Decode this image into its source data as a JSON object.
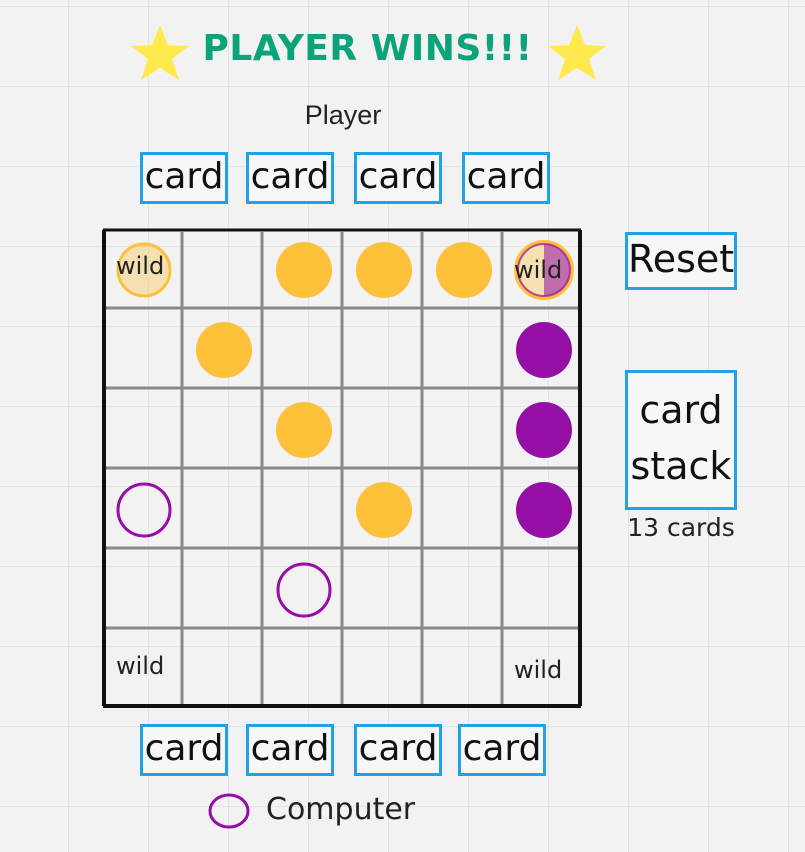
{
  "status": {
    "title": "PLAYER WINS!!!"
  },
  "player": {
    "label": "Player",
    "cards": [
      "card",
      "card",
      "card",
      "card"
    ]
  },
  "computer": {
    "label": "Computer",
    "cards": [
      "card",
      "card",
      "card",
      "card"
    ]
  },
  "controls": {
    "reset_label": "Reset",
    "stack_line1": "card",
    "stack_line2": "stack",
    "stack_count": "13 cards"
  },
  "board": {
    "size": 6,
    "wild_label": "wild",
    "wild_cells": [
      [
        0,
        0
      ],
      [
        0,
        5
      ],
      [
        5,
        0
      ],
      [
        5,
        5
      ]
    ],
    "pieces": [
      {
        "row": 0,
        "col": 0,
        "owner": "player",
        "style": "faded"
      },
      {
        "row": 0,
        "col": 2,
        "owner": "player",
        "style": "solid"
      },
      {
        "row": 0,
        "col": 3,
        "owner": "player",
        "style": "solid"
      },
      {
        "row": 0,
        "col": 4,
        "owner": "player",
        "style": "solid"
      },
      {
        "row": 0,
        "col": 5,
        "owner": "both",
        "style": "split"
      },
      {
        "row": 1,
        "col": 1,
        "owner": "player",
        "style": "solid"
      },
      {
        "row": 1,
        "col": 5,
        "owner": "computer",
        "style": "solid"
      },
      {
        "row": 2,
        "col": 2,
        "owner": "player",
        "style": "solid"
      },
      {
        "row": 2,
        "col": 5,
        "owner": "computer",
        "style": "solid"
      },
      {
        "row": 3,
        "col": 0,
        "owner": "computer",
        "style": "outline"
      },
      {
        "row": 3,
        "col": 3,
        "owner": "player",
        "style": "solid"
      },
      {
        "row": 3,
        "col": 5,
        "owner": "computer",
        "style": "solid"
      },
      {
        "row": 4,
        "col": 2,
        "owner": "computer",
        "style": "outline"
      }
    ]
  },
  "colors": {
    "title": "#0aa37a",
    "star": "#ffe94d",
    "player_piece": "#fcc138",
    "computer_piece": "#950ea6",
    "card_border": "#1fa3e6",
    "grid": "#888888"
  },
  "icons": {
    "star": "star-icon",
    "computer_marker": "computer-marker-icon"
  }
}
